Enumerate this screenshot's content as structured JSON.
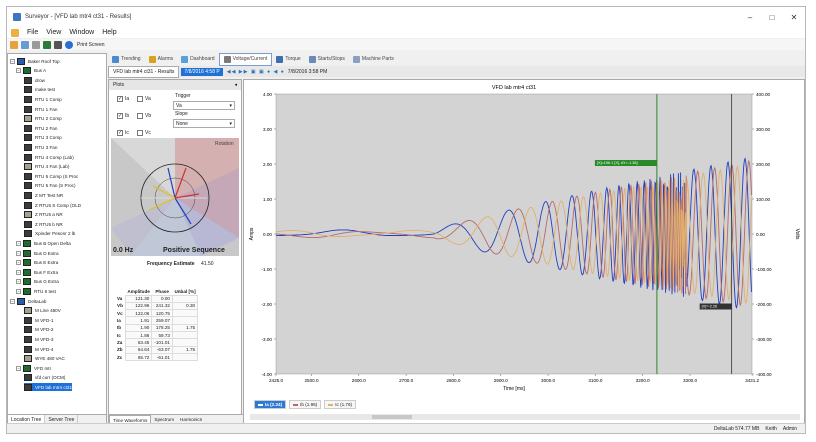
{
  "window": {
    "title": "Surveyor - [VFD lab mtr4 ct31 - Results]",
    "controls": [
      "–",
      "□",
      "✕"
    ]
  },
  "menu": [
    "File",
    "View",
    "Window",
    "Help"
  ],
  "toolbar": {
    "print_label": "Print Screen"
  },
  "tree": {
    "items": [
      {
        "label": "Baker Roof Top",
        "type": "root"
      },
      {
        "label": "Bus A",
        "type": "bus"
      },
      {
        "label": "drow",
        "type": "meter"
      },
      {
        "label": "make test",
        "type": "meter"
      },
      {
        "label": "RTU 1 Comp",
        "type": "meter"
      },
      {
        "label": "RTU 1 Fan",
        "type": "meter"
      },
      {
        "label": "RTU 2 Comp",
        "type": "meter"
      },
      {
        "label": "RTU 2 Fan",
        "type": "meter"
      },
      {
        "label": "RTU 3 Comp",
        "type": "meter"
      },
      {
        "label": "RTU 3 Fan",
        "type": "meter"
      },
      {
        "label": "RTU 4 Comp (Lab)",
        "type": "meter"
      },
      {
        "label": "RTU 4 Fan (Lab)",
        "type": "meter"
      },
      {
        "label": "RTU 5 Comp (S Proc",
        "type": "meter"
      },
      {
        "label": "RTU 5 Fan (S Proc)",
        "type": "meter"
      },
      {
        "label": "Z MT Test NR",
        "type": "meter"
      },
      {
        "label": "Z RTU5 S Comp (OLD",
        "type": "meter"
      },
      {
        "label": "Z RTU5 a NR",
        "type": "meter"
      },
      {
        "label": "Z RTU5 b NR",
        "type": "meter"
      },
      {
        "label": "Xpinder Pesonr 2 lb",
        "type": "meter"
      },
      {
        "label": "Bus B Open Delta",
        "type": "bus"
      },
      {
        "label": "Bus D Extra",
        "type": "bus"
      },
      {
        "label": "Bus E Extra",
        "type": "bus"
      },
      {
        "label": "Bus F Extra",
        "type": "bus"
      },
      {
        "label": "Bus G Extra",
        "type": "bus"
      },
      {
        "label": "RTU 6 test",
        "type": "bus"
      },
      {
        "label": "DeltaLab",
        "type": "root"
      },
      {
        "label": "M Line 480V",
        "type": "meter"
      },
      {
        "label": "M VFD-1",
        "type": "meter"
      },
      {
        "label": "M VFD-2",
        "type": "meter"
      },
      {
        "label": "M VFD-3",
        "type": "meter"
      },
      {
        "label": "M VFD-4",
        "type": "meter"
      },
      {
        "label": "WYE 480 VAC",
        "type": "meter"
      },
      {
        "label": "VFD mtr",
        "type": "bus"
      },
      {
        "label": "vfd curr (OCM)",
        "type": "meter"
      },
      {
        "label": "VFD lab mtr4 ct31",
        "type": "meter"
      }
    ],
    "bottom_tabs": [
      "Location Tree",
      "Server Tree"
    ]
  },
  "tabs": [
    "Trending",
    "Alarms",
    "Dashboard",
    "Voltage/Current",
    "Torque",
    "Starts/Stops",
    "Machine Parts"
  ],
  "subbar": {
    "doc_label": "VFD lab mtr4 ct31 - Results",
    "date": "7/8/2016 4:58 P",
    "date2": "7/8/2016 3:58 PM"
  },
  "plots_panel": {
    "header": "Plots",
    "checks": [
      {
        "label": "Ia",
        "checked": true
      },
      {
        "label": "Va",
        "checked": false
      },
      {
        "label": "Ib",
        "checked": true
      },
      {
        "label": "Vb",
        "checked": false
      },
      {
        "label": "Ic",
        "checked": true
      },
      {
        "label": "Vc",
        "checked": false
      }
    ],
    "trigger_label": "Trigger",
    "trigger_value": "Va",
    "slope_label": "Slope",
    "slope_value": "None",
    "rotation_label": "Rotation",
    "freq_text": "0.0 Hz",
    "sequence_text": "Positive Sequence",
    "freq_est_label": "Frequency Estimate",
    "freq_est_value": "41.50",
    "table_headers": [
      "",
      "Amplitude",
      "Phase",
      "Unbal [%]"
    ],
    "table_rows": [
      [
        "Va",
        "121.30",
        "0.00",
        ""
      ],
      [
        "Vb",
        "122.96",
        "241.32",
        "0.30"
      ],
      [
        "Vc",
        "122.06",
        "120.75",
        ""
      ],
      [
        "Ia",
        "1.91",
        "259.07",
        ""
      ],
      [
        "Ib",
        "1.90",
        "178.25",
        "1.75"
      ],
      [
        "Ic",
        "1.86",
        "59.73",
        ""
      ],
      [
        "Za",
        "63.45",
        "-101.01",
        ""
      ],
      [
        "Zb",
        "64.64",
        "-63.07",
        "1.75"
      ],
      [
        "Zc",
        "65.72",
        "-61.01",
        ""
      ]
    ],
    "bottom_tabs": [
      "Time Waveforms",
      "Spectrum",
      "Harmonics"
    ]
  },
  "chart_data": {
    "type": "line",
    "title": "VFD lab mtr4 ct31",
    "xlabel": "Time [ms]",
    "ylabel": "Amps",
    "y2label": "Volts",
    "xlim": [
      2425,
      3431
    ],
    "ylim": [
      -4,
      4
    ],
    "y2lim": [
      -400,
      400
    ],
    "xticks": [
      "2425.0",
      "2500.0",
      "2600.0",
      "2700.0",
      "2800.0",
      "2900.0",
      "3000.0",
      "3100.0",
      "3200.0",
      "3300.0",
      "3431.2"
    ],
    "yticks": [
      "4.00",
      "3.00",
      "2.00",
      "1.00",
      "0.00",
      "-1.00",
      "-2.00",
      "-3.00",
      "-4.00"
    ],
    "y2ticks": [
      "400.00",
      "300.00",
      "200.00",
      "100.00",
      "0.00",
      "-100.00",
      "-200.00",
      "-300.00",
      "-400.00"
    ],
    "grid": false,
    "series": [
      {
        "name": "Ia (2.24)",
        "color": "#1f3fbf",
        "start": 2425,
        "env_start": 2760,
        "freq_hz": 30,
        "phase": 259,
        "amp_end": 2.2
      },
      {
        "name": "Ib (1.96)",
        "color": "#b86a6a",
        "start": 2425,
        "env_start": 2760,
        "freq_hz": 30,
        "phase": 178,
        "amp_end": 2.1
      },
      {
        "name": "Ic (1.76)",
        "color": "#e0b070",
        "start": 2425,
        "env_start": 2760,
        "freq_hz": 30,
        "phase": 60,
        "amp_end": 2.0
      }
    ],
    "cursor1": {
      "x": 3230,
      "label": "[X]=196.1 [X], AY=-1.36]"
    },
    "cursor2": {
      "x": 3388,
      "label": "[X]=-2.26"
    }
  },
  "colors": {
    "accent": "#1f71d6",
    "chart_bg": "#d3d3d3",
    "cursor": "#2a8a2a"
  },
  "status": {
    "user": "DeltaLab 574.77 MB",
    "name": "Keith",
    "role": "Admin"
  }
}
